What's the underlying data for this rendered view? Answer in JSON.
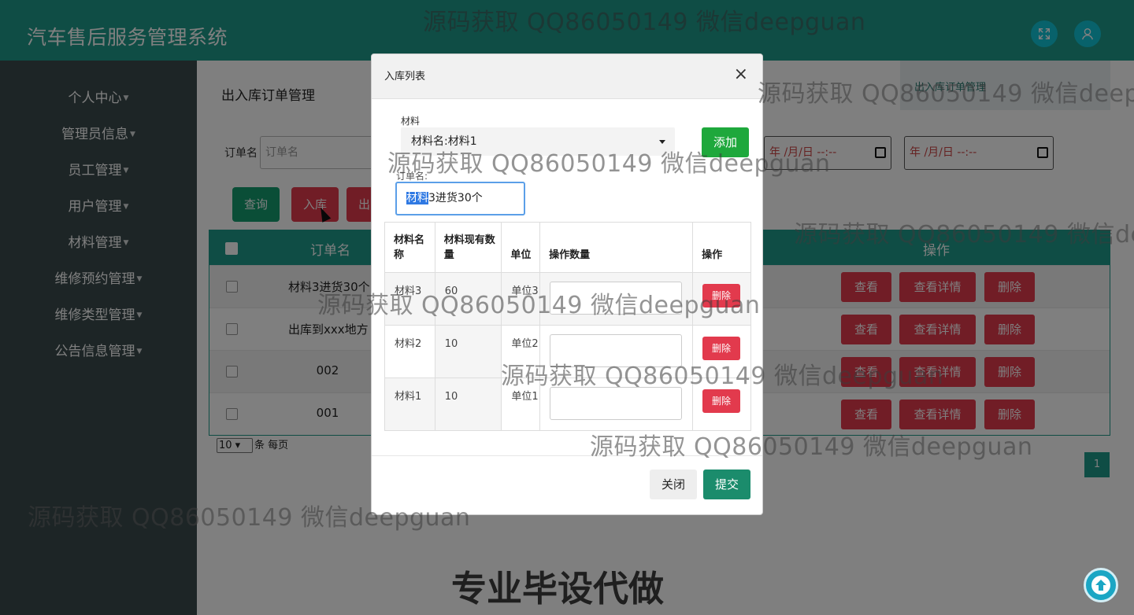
{
  "app": {
    "title": "汽车售后服务管理系统"
  },
  "sidebar": {
    "items": [
      {
        "label": "个人中心"
      },
      {
        "label": "管理员信息"
      },
      {
        "label": "员工管理"
      },
      {
        "label": "用户管理"
      },
      {
        "label": "材料管理"
      },
      {
        "label": "维修预约管理"
      },
      {
        "label": "维修类型管理"
      },
      {
        "label": "公告信息管理"
      }
    ]
  },
  "main": {
    "page_title": "出入库订单管理",
    "breadcrumb": "出入库订单管理",
    "filter_label": "订单名",
    "filter_placeholder": "订单名",
    "date_placeholder_1": "年 /月/日 --:--",
    "date_placeholder_2": "年 /月/日 --:--",
    "buttons": {
      "query": "查询",
      "in": "入库",
      "out": "出"
    },
    "table": {
      "header_name": "订单名",
      "header_actions": "操作",
      "rows": [
        {
          "name": "材料3进货30个"
        },
        {
          "name": "出库到xxx地方"
        },
        {
          "name": "002"
        },
        {
          "name": "001"
        }
      ],
      "row_buttons": {
        "view": "查看",
        "detail": "查看详情",
        "delete": "删除"
      }
    },
    "pager": {
      "page_size": "10",
      "per_page_label": "条 每页",
      "current_page": "1"
    }
  },
  "modal": {
    "title": "入库列表",
    "close_symbol": "×",
    "material_label": "材料",
    "material_selected": "材料名:材料1",
    "add_button": "添加",
    "order_label": "订单名:",
    "order_value_selected": "材料",
    "order_value_rest": "3进货30个",
    "table": {
      "headers": [
        "材料名称",
        "材料现有数量",
        "单位",
        "操作数量",
        "操作"
      ],
      "rows": [
        {
          "name": "材料3",
          "qty": "60",
          "unit": "单位3",
          "op_qty": "",
          "action": "删除"
        },
        {
          "name": "材料2",
          "qty": "10",
          "unit": "单位2",
          "op_qty": "",
          "action": "删除"
        },
        {
          "name": "材料1",
          "qty": "10",
          "unit": "单位1",
          "op_qty": "",
          "action": "删除"
        }
      ]
    },
    "footer": {
      "close": "关闭",
      "submit": "提交"
    }
  },
  "watermarks": {
    "text": "源码获取 QQ86050149 微信deepguan",
    "banner": "专业毕设代做"
  }
}
